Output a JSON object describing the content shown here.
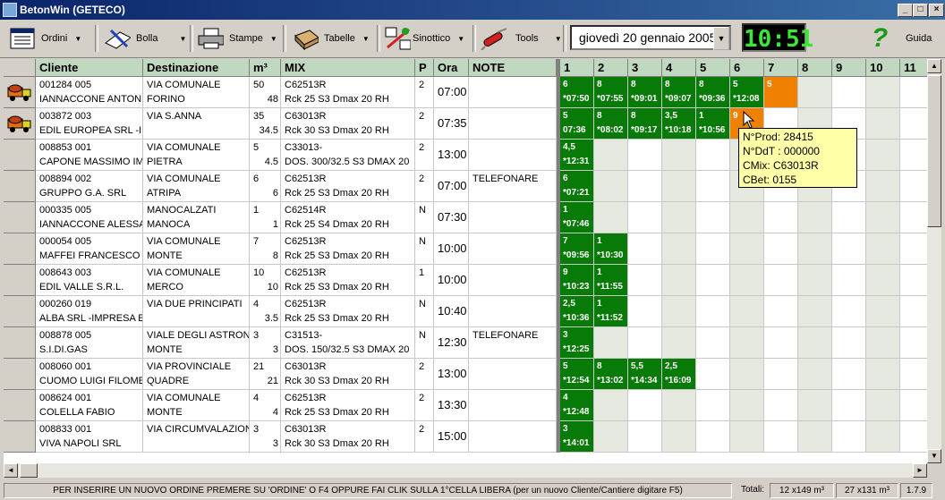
{
  "window": {
    "title": "BetonWin (GETECO)",
    "minimize": "_",
    "maximize": "□",
    "close": "×"
  },
  "toolbar": {
    "ordini": "Ordini",
    "bolla": "Bolla",
    "stampe": "Stampe",
    "tabelle": "Tabelle",
    "sinottico": "Sinottico",
    "tools": "Tools",
    "guida": "Guida",
    "date": "giovedì   20  gennaio  2005",
    "clock": "10:51"
  },
  "columns": {
    "cliente": "Cliente",
    "destinazione": "Destinazione",
    "m3": "m³",
    "mix": "MIX",
    "p": "P",
    "ora": "Ora",
    "note": "NOTE",
    "slots": [
      "1",
      "2",
      "3",
      "4",
      "5",
      "6",
      "7",
      "8",
      "9",
      "10",
      "11"
    ]
  },
  "rows": [
    {
      "code": "001284 005",
      "name": "IANNACCONE ANTON",
      "dest1": "VIA COMUNALE",
      "dest2": "FORINO",
      "m3a": "50",
      "m3b": "48",
      "mix1": "C62513R",
      "mix2": "Rck 25 S3 Dmax 20 RH",
      "p": "2",
      "ora": "07:00",
      "note": "",
      "truck": true,
      "prods": [
        {
          "q": "6",
          "t": "*07:50"
        },
        {
          "q": "8",
          "t": "*07:55"
        },
        {
          "q": "8",
          "t": "*09:01"
        },
        {
          "q": "8",
          "t": "*09:07"
        },
        {
          "q": "8",
          "t": "*09:36"
        },
        {
          "q": "5",
          "t": "*12:08"
        },
        {
          "q": "5",
          "t": "",
          "orange": true
        }
      ]
    },
    {
      "code": "003872 003",
      "name": "EDIL EUROPEA SRL -IM",
      "dest1": "VIA S.ANNA",
      "dest2": "",
      "m3a": "35",
      "m3b": "34.5",
      "mix1": "C63013R",
      "mix2": "Rck 30 S3 Dmax 20 RH",
      "p": "2",
      "ora": "07:35",
      "note": "",
      "truck": true,
      "prods": [
        {
          "q": "5",
          "t": "07:36"
        },
        {
          "q": "8",
          "t": "*08:02"
        },
        {
          "q": "8",
          "t": "*09:17"
        },
        {
          "q": "3,5",
          "t": "*10:18"
        },
        {
          "q": "1",
          "t": "*10:56"
        },
        {
          "q": "9",
          "t": "",
          "orange": true
        }
      ]
    },
    {
      "code": "008853 001",
      "name": "CAPONE MASSIMO IMP",
      "dest1": "VIA COMUNALE",
      "dest2": "PIETRA",
      "m3a": "5",
      "m3b": "4.5",
      "mix1": "C33013-",
      "mix2": "DOS. 300/32.5 S3 DMAX 20",
      "p": "2",
      "ora": "13:00",
      "note": "",
      "prods": [
        {
          "q": "4,5",
          "t": "*12:31"
        }
      ]
    },
    {
      "code": "008894 002",
      "name": "GRUPPO G.A. SRL",
      "dest1": "VIA COMUNALE",
      "dest2": "ATRIPA",
      "m3a": "6",
      "m3b": "6",
      "mix1": "C62513R",
      "mix2": "Rck 25 S3 Dmax 20 RH",
      "p": "2",
      "ora": "07:00",
      "note": "TELEFONARE",
      "prods": [
        {
          "q": "6",
          "t": "*07:21"
        }
      ]
    },
    {
      "code": "000335 005",
      "name": "IANNACCONE ALESSAN",
      "dest1": "MANOCALZATI",
      "dest2": "MANOCA",
      "m3a": "1",
      "m3b": "1",
      "mix1": "C62514R",
      "mix2": "Rck 25 S4 Dmax 20 RH",
      "p": "N",
      "ora": "07:30",
      "note": "",
      "prods": [
        {
          "q": "1",
          "t": "*07:46"
        }
      ]
    },
    {
      "code": "000054 005",
      "name": "MAFFEI FRANCESCO",
      "dest1": "VIA COMUNALE",
      "dest2": "MONTE",
      "m3a": "7",
      "m3b": "8",
      "mix1": "C62513R",
      "mix2": "Rck 25 S3 Dmax 20 RH",
      "p": "N",
      "ora": "10:00",
      "note": "",
      "prods": [
        {
          "q": "7",
          "t": "*09:56"
        },
        {
          "q": "1",
          "t": "*10:30"
        }
      ]
    },
    {
      "code": "008643 003",
      "name": "EDIL VALLE S.R.L.",
      "dest1": "VIA COMUNALE",
      "dest2": "MERCO",
      "m3a": "10",
      "m3b": "10",
      "mix1": "C62513R",
      "mix2": "Rck 25 S3 Dmax 20 RH",
      "p": "1",
      "ora": "10:00",
      "note": "",
      "prods": [
        {
          "q": "9",
          "t": "*10:23"
        },
        {
          "q": "1",
          "t": "*11:55"
        }
      ]
    },
    {
      "code": "000260 019",
      "name": "ALBA SRL -IMPRESA E",
      "dest1": "VIA DUE PRINCIPATI",
      "dest2": "",
      "m3a": "4",
      "m3b": "3.5",
      "mix1": "C62513R",
      "mix2": "Rck 25 S3 Dmax 20 RH",
      "p": "N",
      "ora": "10:40",
      "note": "",
      "prods": [
        {
          "q": "2,5",
          "t": "*10:36"
        },
        {
          "q": "1",
          "t": "*11:52"
        }
      ]
    },
    {
      "code": "008878 005",
      "name": "S.I.DI.GAS",
      "dest1": "VIALE DEGLI ASTRONA",
      "dest2": "MONTE",
      "m3a": "3",
      "m3b": "3",
      "mix1": "C31513-",
      "mix2": "DOS. 150/32.5 S3 DMAX 20",
      "p": "N",
      "ora": "12:30",
      "note": "TELEFONARE",
      "prods": [
        {
          "q": "3",
          "t": "*12:25"
        }
      ]
    },
    {
      "code": "008060 001",
      "name": "CUOMO LUIGI FILOME",
      "dest1": "VIA PROVINCIALE",
      "dest2": "QUADRE",
      "m3a": "21",
      "m3b": "21",
      "mix1": "C63013R",
      "mix2": "Rck 30 S3 Dmax 20 RH",
      "p": "2",
      "ora": "13:00",
      "note": "",
      "prods": [
        {
          "q": "5",
          "t": "*12:54"
        },
        {
          "q": "8",
          "t": "*13:02"
        },
        {
          "q": "5,5",
          "t": "*14:34"
        },
        {
          "q": "2,5",
          "t": "*16:09"
        }
      ]
    },
    {
      "code": "008624 001",
      "name": "COLELLA FABIO",
      "dest1": "VIA COMUNALE",
      "dest2": "MONTE",
      "m3a": "4",
      "m3b": "4",
      "mix1": "C62513R",
      "mix2": "Rck 25 S3 Dmax 20 RH",
      "p": "2",
      "ora": "13:30",
      "note": "",
      "prods": [
        {
          "q": "4",
          "t": "*12:48"
        }
      ]
    },
    {
      "code": "008833 001",
      "name": "VIVA NAPOLI SRL",
      "dest1": "VIA CIRCUMVALAZION",
      "dest2": "",
      "m3a": "3",
      "m3b": "3",
      "mix1": "C63013R",
      "mix2": "Rck 30 S3 Dmax 20 RH",
      "p": "2",
      "ora": "15:00",
      "note": "",
      "prods": [
        {
          "q": "3",
          "t": "*14:01"
        }
      ]
    }
  ],
  "tooltip": {
    "l1": "N°Prod: 28415",
    "l2": "N°DdT : 000000",
    "l3": "CMix: C63013R",
    "l4": "CBet: 0155"
  },
  "status": {
    "msg": "PER INSERIRE UN NUOVO ORDINE PREMERE SU 'ORDINE' O F4 OPPURE FAI CLIK SULLA 1°CELLA LIBERA  (per un nuovo Cliente/Cantiere digitare F5)",
    "totali": "Totali:",
    "t1": "12 x149 m³",
    "t2": "27 x131 m³",
    "ver": "1.7.9"
  }
}
